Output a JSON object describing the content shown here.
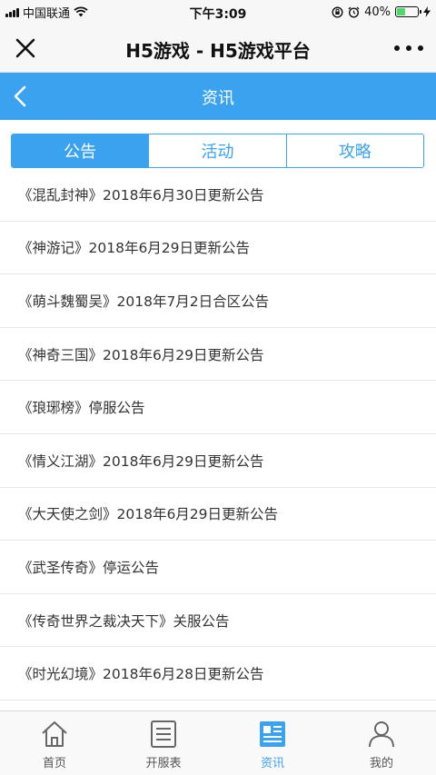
{
  "status_bar": {
    "carrier": "中国联通",
    "time": "下午3:09",
    "battery": "40%",
    "battery_level": 0.4
  },
  "title_bar": {
    "title": "H5游戏 - H5游戏平台",
    "close_icon": "close-icon",
    "more_icon": "more-icon"
  },
  "header": {
    "title": "资讯",
    "back_icon": "chevron-left-icon",
    "color": "#3aa2ef"
  },
  "tabs": [
    {
      "label": "公告",
      "active": true
    },
    {
      "label": "活动",
      "active": false
    },
    {
      "label": "攻略",
      "active": false
    }
  ],
  "news": [
    "《混乱封神》2018年6月30日更新公告",
    "《神游记》2018年6月29日更新公告",
    "《萌斗魏蜀吴》2018年7月2日合区公告",
    "《神奇三国》2018年6月29日更新公告",
    "《琅琊榜》停服公告",
    "《情义江湖》2018年6月29日更新公告",
    "《大天使之剑》2018年6月29日更新公告",
    "《武圣传奇》停运公告",
    "《传奇世界之裁决天下》关服公告",
    "《时光幻境》2018年6月28日更新公告"
  ],
  "bottom_nav": [
    {
      "label": "首页",
      "icon": "home-icon",
      "active": false
    },
    {
      "label": "开服表",
      "icon": "server-list-icon",
      "active": false
    },
    {
      "label": "资讯",
      "icon": "news-icon",
      "active": true
    },
    {
      "label": "我的",
      "icon": "user-icon",
      "active": false
    }
  ]
}
